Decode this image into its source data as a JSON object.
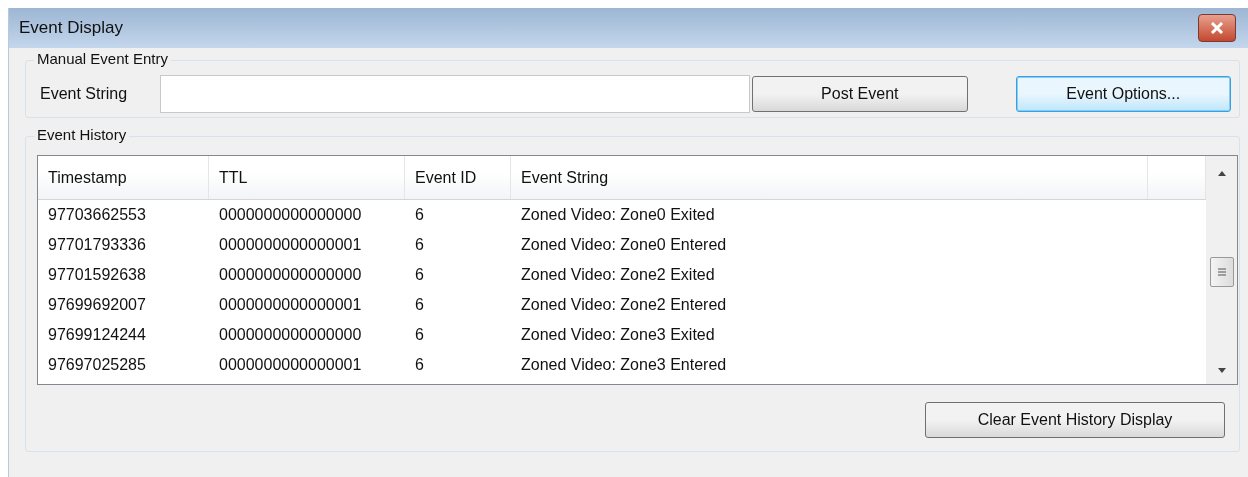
{
  "window": {
    "title": "Event Display"
  },
  "manual_entry": {
    "legend": "Manual Event Entry",
    "label": "Event String",
    "buttons": [
      {
        "label": "Post Event",
        "focused": false
      },
      {
        "label": "Event Options...",
        "focused": true
      }
    ]
  },
  "history": {
    "legend": "Event History",
    "columns": [
      "Timestamp",
      "TTL",
      "Event ID",
      "Event String"
    ],
    "rows": [
      [
        "97703662553",
        "0000000000000000",
        "6",
        "Zoned Video: Zone0 Exited"
      ],
      [
        "97701793336",
        "0000000000000001",
        "6",
        "Zoned Video: Zone0 Entered"
      ],
      [
        "97701592638",
        "0000000000000000",
        "6",
        "Zoned Video: Zone2 Exited"
      ],
      [
        "97699692007",
        "0000000000000001",
        "6",
        "Zoned Video: Zone2 Entered"
      ],
      [
        "97699124244",
        "0000000000000000",
        "6",
        "Zoned Video: Zone3 Exited"
      ],
      [
        "97697025285",
        "0000000000000001",
        "6",
        "Zoned Video: Zone3 Entered"
      ]
    ],
    "clear_button": "Clear Event History Display"
  }
}
